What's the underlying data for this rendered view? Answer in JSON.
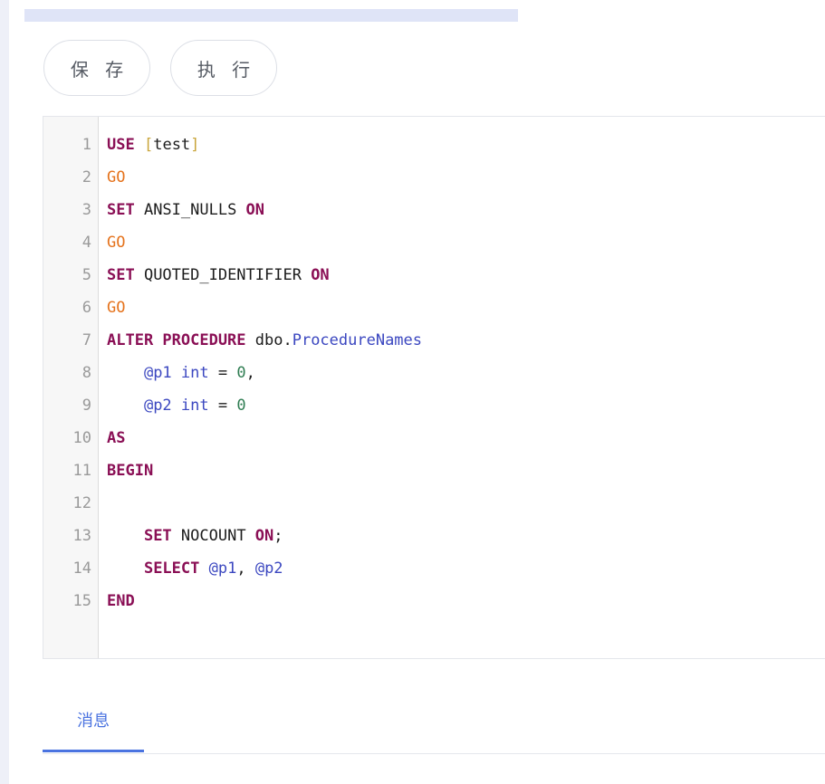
{
  "toolbar": {
    "save_label": "保 存",
    "run_label": "执 行"
  },
  "editor": {
    "line_numbers": [
      "1",
      "2",
      "3",
      "4",
      "5",
      "6",
      "7",
      "8",
      "9",
      "10",
      "11",
      "12",
      "13",
      "14",
      "15"
    ],
    "lines": [
      [
        {
          "t": "USE",
          "c": "kw"
        },
        {
          "t": " ",
          "c": "id"
        },
        {
          "t": "[",
          "c": "br"
        },
        {
          "t": "test",
          "c": "id"
        },
        {
          "t": "]",
          "c": "br"
        }
      ],
      [
        {
          "t": "GO",
          "c": "go"
        }
      ],
      [
        {
          "t": "SET",
          "c": "kw"
        },
        {
          "t": " ANSI_NULLS ",
          "c": "id"
        },
        {
          "t": "ON",
          "c": "kw"
        }
      ],
      [
        {
          "t": "GO",
          "c": "go"
        }
      ],
      [
        {
          "t": "SET",
          "c": "kw"
        },
        {
          "t": " QUOTED_IDENTIFIER ",
          "c": "id"
        },
        {
          "t": "ON",
          "c": "kw"
        }
      ],
      [
        {
          "t": "GO",
          "c": "go"
        }
      ],
      [
        {
          "t": "ALTER PROCEDURE",
          "c": "kw"
        },
        {
          "t": " dbo.",
          "c": "id"
        },
        {
          "t": "ProcedureNames",
          "c": "fn"
        }
      ],
      [
        {
          "t": "    ",
          "c": "id"
        },
        {
          "t": "@p1",
          "c": "ty"
        },
        {
          "t": " ",
          "c": "id"
        },
        {
          "t": "int",
          "c": "ty"
        },
        {
          "t": " = ",
          "c": "id"
        },
        {
          "t": "0",
          "c": "nm"
        },
        {
          "t": ",",
          "c": "id"
        }
      ],
      [
        {
          "t": "    ",
          "c": "id"
        },
        {
          "t": "@p2",
          "c": "ty"
        },
        {
          "t": " ",
          "c": "id"
        },
        {
          "t": "int",
          "c": "ty"
        },
        {
          "t": " = ",
          "c": "id"
        },
        {
          "t": "0",
          "c": "nm"
        }
      ],
      [
        {
          "t": "AS",
          "c": "kw"
        }
      ],
      [
        {
          "t": "BEGIN",
          "c": "kw"
        }
      ],
      [],
      [
        {
          "t": "    ",
          "c": "id"
        },
        {
          "t": "SET",
          "c": "kw"
        },
        {
          "t": " NOCOUNT ",
          "c": "id"
        },
        {
          "t": "ON",
          "c": "kw"
        },
        {
          "t": ";",
          "c": "id"
        }
      ],
      [
        {
          "t": "    ",
          "c": "id"
        },
        {
          "t": "SELECT",
          "c": "kw"
        },
        {
          "t": " ",
          "c": "id"
        },
        {
          "t": "@p1",
          "c": "ty"
        },
        {
          "t": ", ",
          "c": "id"
        },
        {
          "t": "@p2",
          "c": "ty"
        }
      ],
      [
        {
          "t": "END",
          "c": "kw"
        }
      ]
    ]
  },
  "tabs": {
    "messages_label": "消息"
  },
  "colors": {
    "keyword": "#8a0f55",
    "go": "#e5731d",
    "bracket": "#c9a53a",
    "variable": "#3b47c0",
    "number": "#2f7d52",
    "accent": "#4a73e0"
  }
}
